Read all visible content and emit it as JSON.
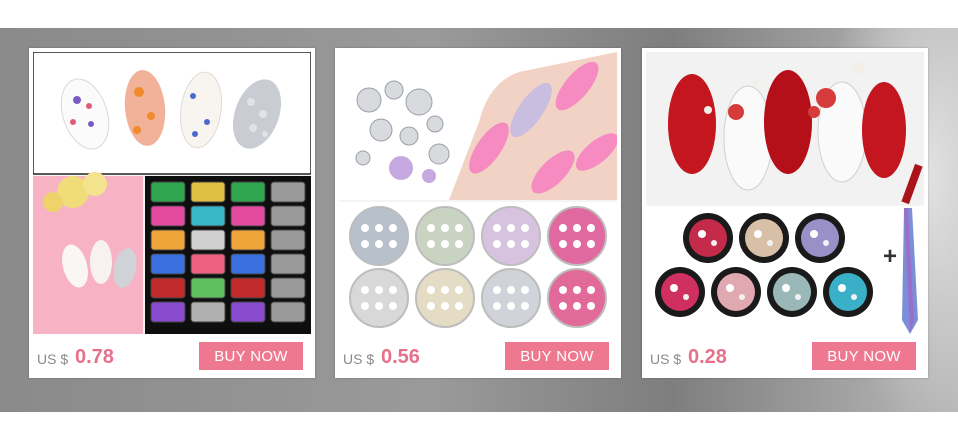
{
  "products": [
    {
      "currency": "US $",
      "price": "0.78",
      "button": "BUY NOW"
    },
    {
      "currency": "US $",
      "price": "0.56",
      "button": "BUY NOW"
    },
    {
      "currency": "US $",
      "price": "0.28",
      "button": "BUY NOW"
    }
  ],
  "colors": {
    "price": "#e8708a",
    "button": "#ee7890",
    "banner": "#8f8f8f"
  },
  "extras": {
    "plus_sign": "+"
  }
}
